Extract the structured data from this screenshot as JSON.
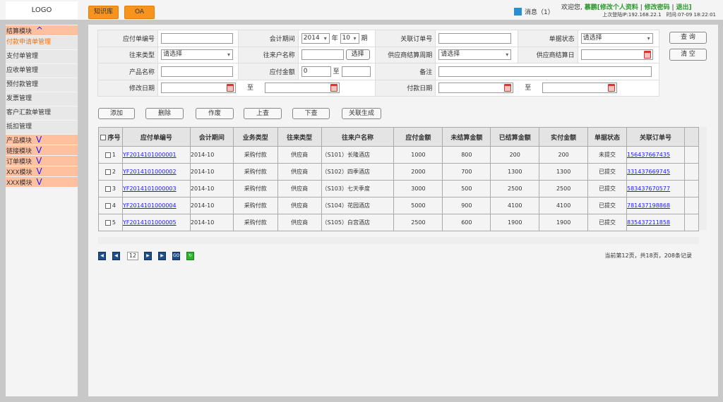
{
  "header": {
    "logo": "LOGO",
    "buttons": [
      "知识库",
      "OA"
    ],
    "message": "消息（1）",
    "welcome": "欢迎您,",
    "user": "慕鹏",
    "edit_profile": "[修改个人资料",
    "edit_password": "修改密码",
    "logout": "退出]",
    "last_login": "上次登陆IP:192.168.22.1　时间:07-09 18:22:01"
  },
  "sidebar": {
    "items": [
      {
        "label": "结算模块",
        "type": "module",
        "arrow": "^"
      },
      {
        "label": "付款申请单管理",
        "active": true
      },
      {
        "label": "支付单管理"
      },
      {
        "label": "应收单管理"
      },
      {
        "label": "预付款管理"
      },
      {
        "label": "发票管理"
      },
      {
        "label": "客户汇款单管理"
      },
      {
        "label": "抵扣管理"
      },
      {
        "label": "产品模块",
        "type": "module",
        "arrow": "V"
      },
      {
        "label": "链接模块",
        "type": "module",
        "arrow": "V"
      },
      {
        "label": "订单模块",
        "type": "module",
        "arrow": "V"
      },
      {
        "label": "XXX模块",
        "type": "module",
        "arrow": "V"
      },
      {
        "label": "XXX模块",
        "type": "module",
        "arrow": "V"
      }
    ]
  },
  "form": {
    "payable_no": "应付单编号",
    "period": "会计期间",
    "period_year": "2014",
    "year_unit": "年",
    "period_month": "10",
    "period_unit": "期",
    "related_order": "关联订单号",
    "doc_status": "单据状态",
    "select_placeholder": "请选择",
    "partner_type": "往来类型",
    "partner_name": "往来户名称",
    "choose": "选择",
    "supplier_cycle": "供应商结算周期",
    "supplier_day": "供应商结算日",
    "product_name": "产品名称",
    "amount": "应付金额",
    "amount_from": "0",
    "to": "至",
    "remark": "备注",
    "modify_date": "修改日期",
    "pay_date": "付款日期",
    "query": "查 询",
    "clear": "清 空"
  },
  "actions": [
    "添加",
    "删除",
    "作废",
    "上查",
    "下查",
    "关联生成"
  ],
  "table": {
    "headers": [
      "序号",
      "应付单编号",
      "会计期间",
      "业务类型",
      "往来类型",
      "往来户名称",
      "应付金额",
      "未结算金额",
      "已结算金额",
      "实付金额",
      "单据状态",
      "关联订单号"
    ],
    "rows": [
      [
        "1",
        "YF2014101000001",
        "2014-10",
        "采购付款",
        "供应商",
        "（S101）长隆酒店",
        "1000",
        "800",
        "200",
        "200",
        "未提交",
        "156437667435"
      ],
      [
        "2",
        "YF2014101000002",
        "2014-10",
        "采购付款",
        "供应商",
        "（S102）四季酒店",
        "2000",
        "700",
        "1300",
        "1300",
        "已提交",
        "331437669745"
      ],
      [
        "3",
        "YF2014101000003",
        "2014-10",
        "采购付款",
        "供应商",
        "（S103）七天季度",
        "3000",
        "500",
        "2500",
        "2500",
        "已提交",
        "583437670577"
      ],
      [
        "4",
        "YF2014101000004",
        "2014-10",
        "采购付款",
        "供应商",
        "（S104）花园酒店",
        "5000",
        "900",
        "4100",
        "4100",
        "已提交",
        "781437198868"
      ],
      [
        "5",
        "YF2014101000005",
        "2014-10",
        "采购付款",
        "供应商",
        "（S105）白宫酒店",
        "2500",
        "600",
        "1900",
        "1900",
        "已提交",
        "835437211858"
      ]
    ]
  },
  "pagination": {
    "page": "12",
    "info": "当前第12页，共18页，208条记录",
    "go": "GO"
  }
}
